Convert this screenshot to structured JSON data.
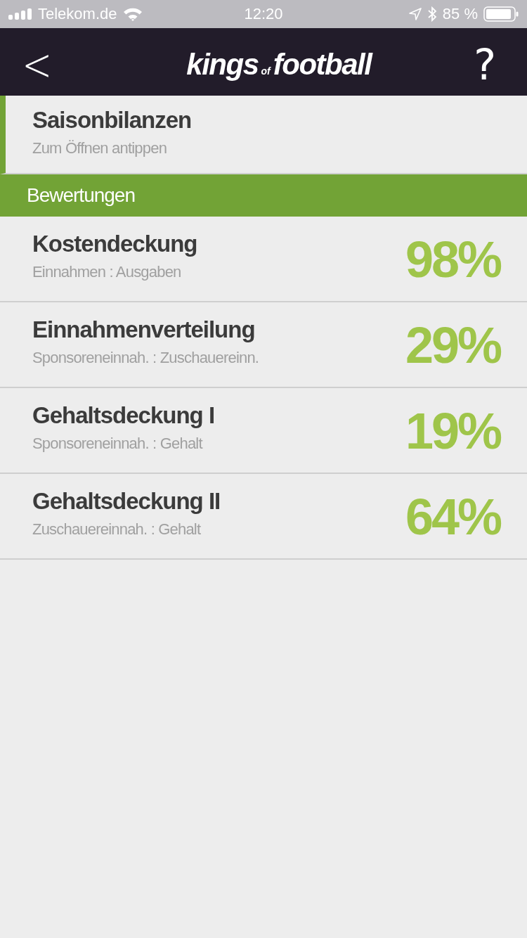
{
  "status_bar": {
    "carrier": "Telekom.de",
    "time": "12:20",
    "battery": "85 %"
  },
  "nav_bar": {
    "back": "<",
    "logo": {
      "main": "kings",
      "small": "of",
      "tail": "football"
    },
    "help": "?"
  },
  "season_item": {
    "title": "Saisonbilanzen",
    "subtitle": "Zum Öffnen antippen"
  },
  "section": {
    "title": "Bewertungen"
  },
  "ratings": [
    {
      "title": "Kostendeckung",
      "subtitle": "Einnahmen : Ausgaben",
      "value": "98%"
    },
    {
      "title": "Einnahmenverteilung",
      "subtitle": "Sponsoreneinnah. : Zuschauereinn.",
      "value": "29%"
    },
    {
      "title": "Gehaltsdeckung I",
      "subtitle": "Sponsoreneinnah. : Gehalt",
      "value": "19%"
    },
    {
      "title": "Gehaltsdeckung II",
      "subtitle": "Zuschauereinnah. : Gehalt",
      "value": "64%"
    }
  ]
}
